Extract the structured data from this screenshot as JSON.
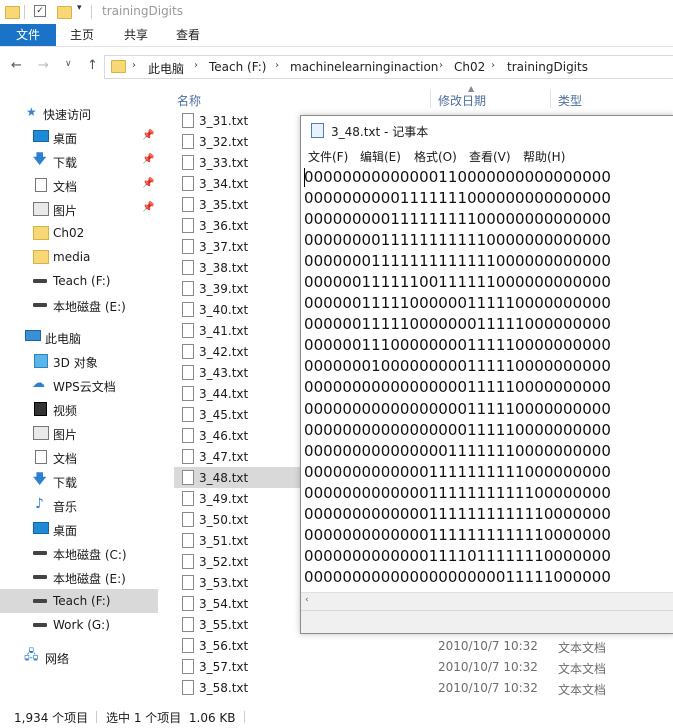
{
  "window": {
    "title": "trainingDigits"
  },
  "ribbon": {
    "tabs": [
      "文件",
      "主页",
      "共享",
      "查看"
    ]
  },
  "address": {
    "crumbs": [
      "此电脑",
      "Teach (F:)",
      "machinelearninginaction",
      "Ch02",
      "trainingDigits"
    ]
  },
  "sidebar": {
    "quick_access_label": "快速访问",
    "quick_items": [
      {
        "label": "桌面",
        "icon": "desktop-icon"
      },
      {
        "label": "下载",
        "icon": "download-icon"
      },
      {
        "label": "文档",
        "icon": "document-icon"
      },
      {
        "label": "图片",
        "icon": "picture-icon"
      },
      {
        "label": "Ch02",
        "icon": "folder-icon"
      },
      {
        "label": "media",
        "icon": "folder-icon"
      },
      {
        "label": "Teach (F:)",
        "icon": "drive-icon"
      },
      {
        "label": "本地磁盘 (E:)",
        "icon": "drive-icon"
      }
    ],
    "pc_label": "此电脑",
    "pc_items": [
      {
        "label": "3D 对象",
        "icon": "3d-objects-icon"
      },
      {
        "label": "WPS云文档",
        "icon": "cloud-icon"
      },
      {
        "label": "视频",
        "icon": "video-icon"
      },
      {
        "label": "图片",
        "icon": "picture-icon"
      },
      {
        "label": "文档",
        "icon": "document-icon"
      },
      {
        "label": "下载",
        "icon": "download-icon"
      },
      {
        "label": "音乐",
        "icon": "music-icon"
      },
      {
        "label": "桌面",
        "icon": "desktop-icon"
      },
      {
        "label": "本地磁盘 (C:)",
        "icon": "drive-icon"
      },
      {
        "label": "本地磁盘 (E:)",
        "icon": "drive-icon"
      },
      {
        "label": "Teach (F:)",
        "icon": "drive-icon",
        "selected": true
      },
      {
        "label": "Work (G:)",
        "icon": "drive-icon"
      }
    ],
    "network_label": "网络"
  },
  "columns": {
    "name": "名称",
    "date": "修改日期",
    "type": "类型"
  },
  "files": [
    {
      "name": "3_31.txt"
    },
    {
      "name": "3_32.txt"
    },
    {
      "name": "3_33.txt"
    },
    {
      "name": "3_34.txt"
    },
    {
      "name": "3_35.txt"
    },
    {
      "name": "3_36.txt"
    },
    {
      "name": "3_37.txt"
    },
    {
      "name": "3_38.txt"
    },
    {
      "name": "3_39.txt"
    },
    {
      "name": "3_40.txt"
    },
    {
      "name": "3_41.txt"
    },
    {
      "name": "3_42.txt"
    },
    {
      "name": "3_43.txt"
    },
    {
      "name": "3_44.txt"
    },
    {
      "name": "3_45.txt"
    },
    {
      "name": "3_46.txt"
    },
    {
      "name": "3_47.txt"
    },
    {
      "name": "3_48.txt",
      "selected": true
    },
    {
      "name": "3_49.txt"
    },
    {
      "name": "3_50.txt"
    },
    {
      "name": "3_51.txt"
    },
    {
      "name": "3_52.txt"
    },
    {
      "name": "3_53.txt"
    },
    {
      "name": "3_54.txt"
    },
    {
      "name": "3_55.txt"
    },
    {
      "name": "3_56.txt",
      "date": "2010/10/7 10:32",
      "type": "文本文档"
    },
    {
      "name": "3_57.txt",
      "date": "2010/10/7 10:32",
      "type": "文本文档"
    },
    {
      "name": "3_58.txt",
      "date": "2010/10/7 10:32",
      "type": "文本文档"
    }
  ],
  "status": {
    "count": "1,934 个项目",
    "selection": "选中 1 个项目  1.06 KB"
  },
  "notepad": {
    "title": "3_48.txt - 记事本",
    "menus": [
      "文件(F)",
      "编辑(E)",
      "格式(O)",
      "查看(V)",
      "帮助(H)"
    ],
    "lines": [
      "00000000000000110000000000000000",
      "00000000001111111000000000000000",
      "00000000011111111100000000000000",
      "00000000111111111110000000000000",
      "00000001111111111111000000000000",
      "00000011111100111111000000000000",
      "00000011111000000111110000000000",
      "00000011111000000011111000000000",
      "00000011100000000111110000000000",
      "00000001000000000111110000000000",
      "00000000000000000111110000000000",
      "00000000000000000111110000000000",
      "00000000000000000111110000000000",
      "00000000000000011111110000000000",
      "00000000000001111111111000000000",
      "00000000000001111111111100000000",
      "00000000000001111111111110000000",
      "00000000000001111111111110000000",
      "00000000000001111011111110000000",
      "00000000000000000000011111000000",
      "00000000000000000000011111000000"
    ]
  }
}
